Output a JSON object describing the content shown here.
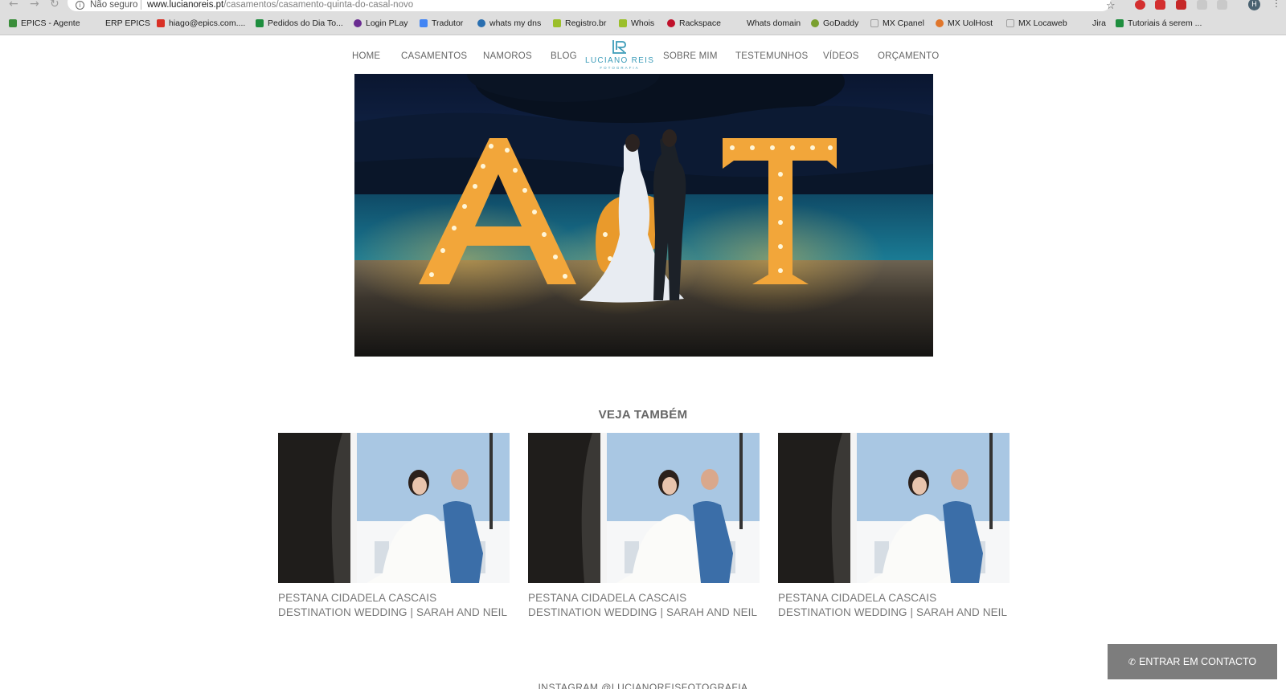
{
  "browser": {
    "security_label": "Não seguro",
    "url_domain": "www.lucianoreis.pt",
    "url_path": "/casamentos/casamento-quinta-do-casal-novo",
    "profile_initial": "H",
    "bookmarks": [
      {
        "label": "EPICS - Agente",
        "color": "#3b8e3b"
      },
      {
        "label": "ERP EPICS",
        "color": ""
      },
      {
        "label": "hiago@epics.com....",
        "color": "#d93025"
      },
      {
        "label": "Pedidos do Dia To...",
        "color": "#1e8e3e"
      },
      {
        "label": "Login PLay",
        "color": "#6a2c91"
      },
      {
        "label": "Tradutor",
        "color": "#4285f4"
      },
      {
        "label": "whats my dns",
        "color": "#2a6fb0"
      },
      {
        "label": "Registro.br",
        "color": "#9bbf2a"
      },
      {
        "label": "Whois",
        "color": "#9bbf2a"
      },
      {
        "label": "Rackspace",
        "color": "#c0112b"
      },
      {
        "label": "Whats domain",
        "color": ""
      },
      {
        "label": "GoDaddy",
        "color": "#7aa02f"
      },
      {
        "label": "MX Cpanel",
        "color": "#9e9e9e"
      },
      {
        "label": "MX UolHost",
        "color": "#e0762b"
      },
      {
        "label": "MX Locaweb",
        "color": "#9e9e9e"
      },
      {
        "label": "Jira",
        "color": ""
      },
      {
        "label": "Tutoriais á serem ...",
        "color": "#1e8e3e"
      }
    ]
  },
  "site": {
    "nav": {
      "home": "HOME",
      "casamentos": "CASAMENTOS",
      "namoros": "NAMOROS",
      "blog": "BLOG",
      "sobre_mim": "SOBRE MIM",
      "testemunhos": "TESTEMUNHOS",
      "videos": "VÍDEOS",
      "orcamento": "ORÇAMENTO"
    },
    "logo": {
      "name": "LUCIANO REIS",
      "tagline": "FOTOGRAFIA"
    },
    "hero": {
      "letters": "A&T",
      "icon": "wedding-couple-photo"
    },
    "related": {
      "title": "VEJA TAMBÉM",
      "items": [
        {
          "title": "PESTANA CIDADELA CASCAIS DESTINATION WEDDING | SARAH AND NEIL"
        },
        {
          "title": "PESTANA CIDADELA CASCAIS DESTINATION WEDDING | SARAH AND NEIL"
        },
        {
          "title": "PESTANA CIDADELA CASCAIS DESTINATION WEDDING | SARAH AND NEIL"
        }
      ]
    },
    "instagram": "INSTAGRAM @LUCIANOREISFOTOGRAFIA",
    "contact_button": "ENTRAR EM CONTACTO",
    "colors": {
      "accent": "#3a9bb8",
      "text_grey": "#666666",
      "contact_bg": "#7d7d7d"
    }
  }
}
